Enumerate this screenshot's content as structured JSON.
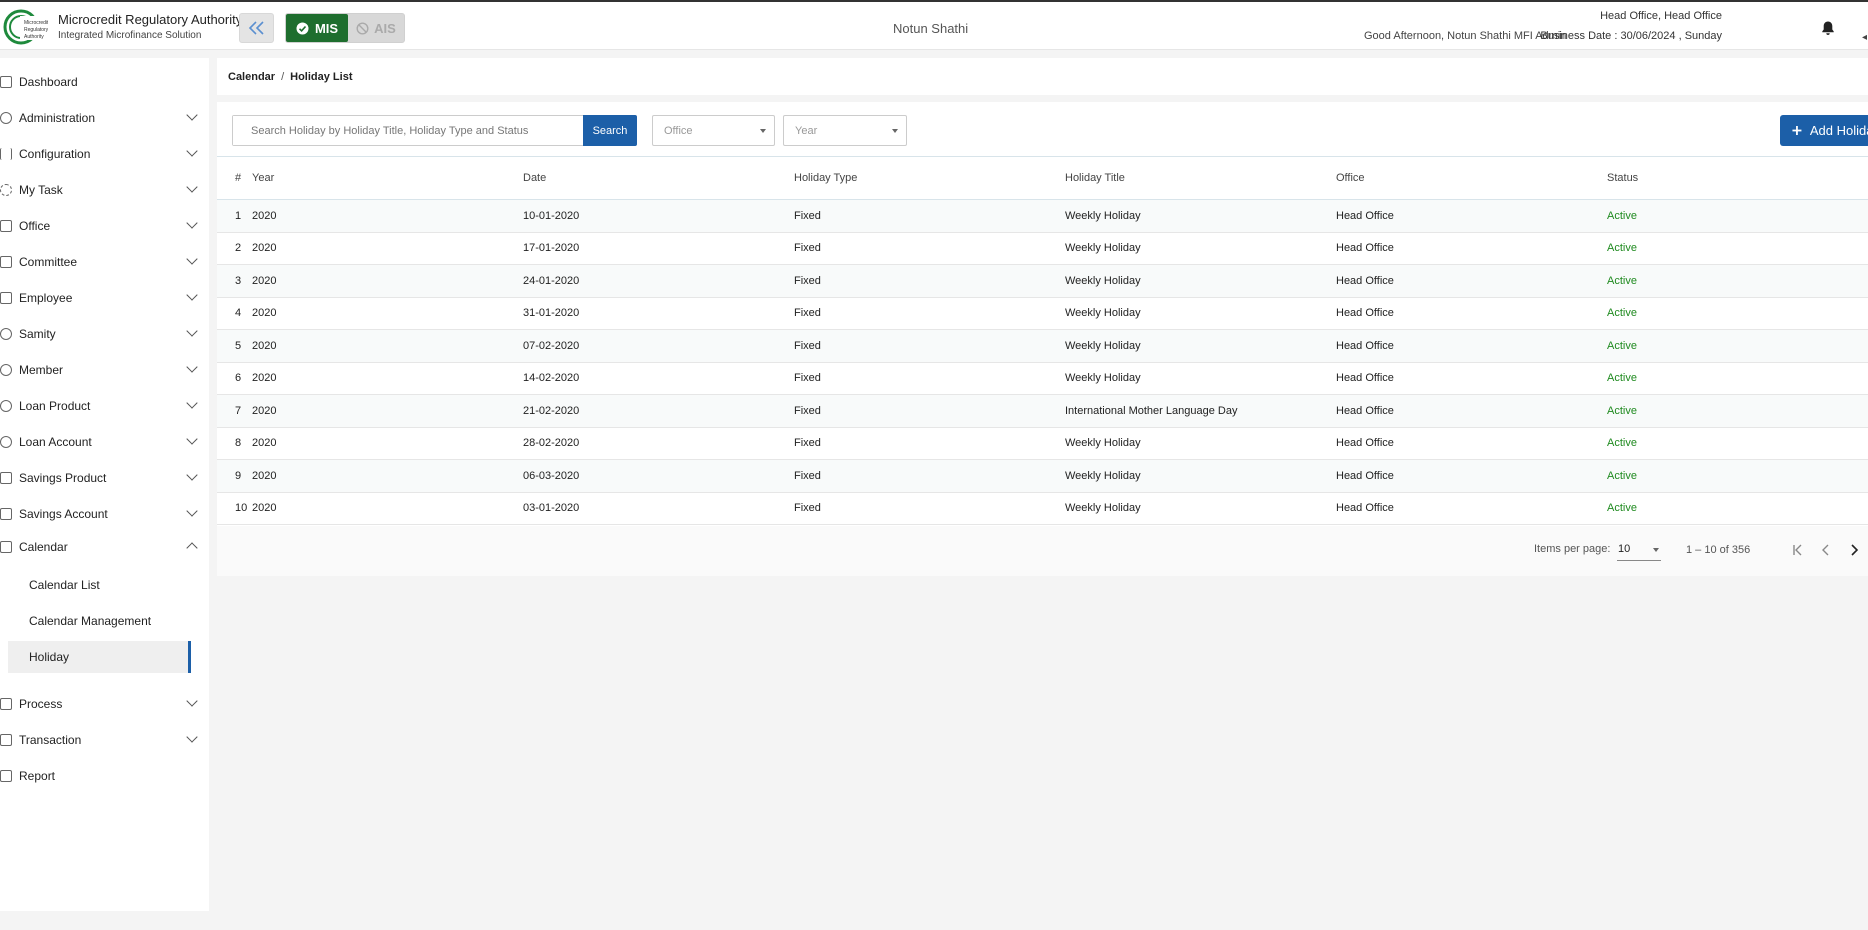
{
  "header": {
    "app_title": "Microcredit Regulatory Authority",
    "app_subtitle": "Integrated Microfinance Solution",
    "logo_text": "Microcredit Regulatory Authority",
    "mode_mis": "MIS",
    "mode_ais": "AIS",
    "org_name": "Notun Shathi",
    "greeting": "Good Afternoon, Notun Shathi MFI Admin",
    "office": "Head Office, Head Office",
    "business_date": "Business Date : 30/06/2024 , Sunday"
  },
  "sidebar": {
    "items": [
      {
        "label": "Dashboard",
        "icon": "dashboard-icon",
        "expandable": false
      },
      {
        "label": "Administration",
        "icon": "admin-icon",
        "expandable": true
      },
      {
        "label": "Configuration",
        "icon": "sliders-icon",
        "expandable": true
      },
      {
        "label": "My Task",
        "icon": "task-icon",
        "expandable": true
      },
      {
        "label": "Office",
        "icon": "office-icon",
        "expandable": true
      },
      {
        "label": "Committee",
        "icon": "committee-icon",
        "expandable": true
      },
      {
        "label": "Employee",
        "icon": "employee-icon",
        "expandable": true
      },
      {
        "label": "Samity",
        "icon": "samity-icon",
        "expandable": true
      },
      {
        "label": "Member",
        "icon": "member-icon",
        "expandable": true
      },
      {
        "label": "Loan Product",
        "icon": "loan-product-icon",
        "expandable": true
      },
      {
        "label": "Loan Account",
        "icon": "loan-account-icon",
        "expandable": true
      },
      {
        "label": "Savings Product",
        "icon": "savings-product-icon",
        "expandable": true
      },
      {
        "label": "Savings Account",
        "icon": "savings-account-icon",
        "expandable": true
      },
      {
        "label": "Calendar",
        "icon": "calendar-icon",
        "expandable": true,
        "expanded": true
      },
      {
        "label": "Process",
        "icon": "process-icon",
        "expandable": true
      },
      {
        "label": "Transaction",
        "icon": "transaction-icon",
        "expandable": true
      },
      {
        "label": "Report",
        "icon": "report-icon",
        "expandable": false
      }
    ],
    "calendar_sub": [
      {
        "label": "Calendar List"
      },
      {
        "label": "Calendar Management"
      },
      {
        "label": "Holiday",
        "active": true
      }
    ]
  },
  "breadcrumb": {
    "parent": "Calendar",
    "separator": "/",
    "current": "Holiday List"
  },
  "toolbar": {
    "search_placeholder": "Search Holiday by Holiday Title, Holiday Type and Status",
    "search_label": "Search",
    "office_placeholder": "Office",
    "year_placeholder": "Year",
    "add_label": "Add Holiday"
  },
  "table": {
    "headers": [
      "#",
      "Year",
      "Date",
      "Holiday Type",
      "Holiday Title",
      "Office",
      "Status"
    ],
    "rows": [
      [
        "1",
        "2020",
        "10-01-2020",
        "Fixed",
        "Weekly Holiday",
        "Head Office",
        "Active"
      ],
      [
        "2",
        "2020",
        "17-01-2020",
        "Fixed",
        "Weekly Holiday",
        "Head Office",
        "Active"
      ],
      [
        "3",
        "2020",
        "24-01-2020",
        "Fixed",
        "Weekly Holiday",
        "Head Office",
        "Active"
      ],
      [
        "4",
        "2020",
        "31-01-2020",
        "Fixed",
        "Weekly Holiday",
        "Head Office",
        "Active"
      ],
      [
        "5",
        "2020",
        "07-02-2020",
        "Fixed",
        "Weekly Holiday",
        "Head Office",
        "Active"
      ],
      [
        "6",
        "2020",
        "14-02-2020",
        "Fixed",
        "Weekly Holiday",
        "Head Office",
        "Active"
      ],
      [
        "7",
        "2020",
        "21-02-2020",
        "Fixed",
        "International Mother Language Day",
        "Head Office",
        "Active"
      ],
      [
        "8",
        "2020",
        "28-02-2020",
        "Fixed",
        "Weekly Holiday",
        "Head Office",
        "Active"
      ],
      [
        "9",
        "2020",
        "06-03-2020",
        "Fixed",
        "Weekly Holiday",
        "Head Office",
        "Active"
      ],
      [
        "10",
        "2020",
        "03-01-2020",
        "Fixed",
        "Weekly Holiday",
        "Head Office",
        "Active"
      ]
    ]
  },
  "pagination": {
    "items_per_page_label": "Items per page:",
    "items_per_page": "10",
    "range": "1 – 10 of 356"
  },
  "colors": {
    "brand_blue": "#1c5fa8",
    "mis_green": "#1e6e2e",
    "status_active": "#1f8a1f"
  }
}
